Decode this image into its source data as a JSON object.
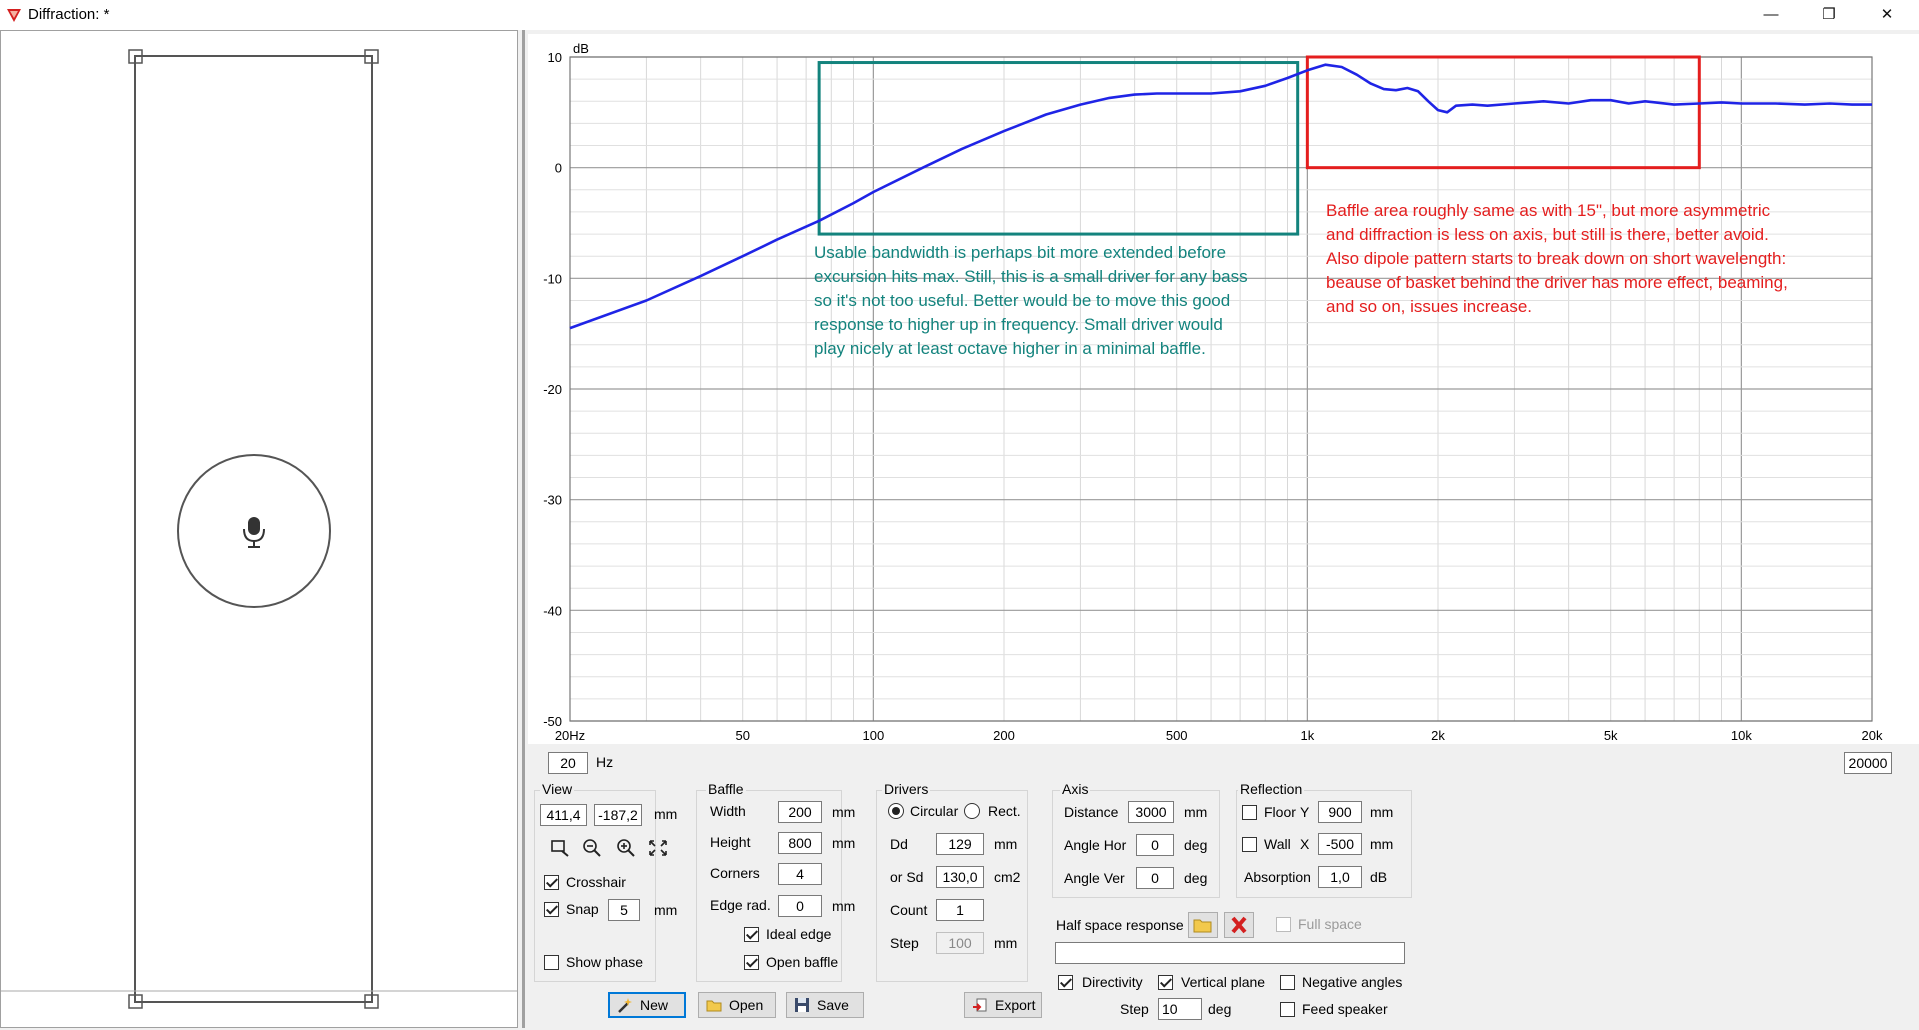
{
  "window": {
    "title": "Diffraction: *",
    "minimize": "—",
    "maximize": "❐",
    "close": "✕"
  },
  "colors": {
    "curve": "#1f24e6",
    "teal": "#13837d",
    "red": "#e41e1e",
    "grid": "#c8c8c8"
  },
  "chart": {
    "y_unit": "dB",
    "y_ticks": [
      "10",
      "0",
      "-10",
      "-20",
      "-30",
      "-40",
      "-50"
    ],
    "x_ticks": [
      "20Hz",
      "50",
      "100",
      "200",
      "500",
      "1k",
      "2k",
      "5k",
      "10k",
      "20k"
    ],
    "annotation_teal": "Usable bandwidth is perhaps bit more extended before\nexcursion hits max. Still, this is a small driver for any bass\nso it's not too useful. Better would be to move this good\nresponse to higher up in frequency. Small driver would\nplay nicely at least octave higher in a minimal baffle.",
    "annotation_red": "Baffle area roughly same as with 15\", but more asymmetric\nand diffraction is less on axis, but still is there, better avoid.\nAlso dipole pattern starts to break down on short wavelength:\nbeause of basket behind the driver has more effect, beaming,\nand so on, issues increase."
  },
  "chart_data": {
    "type": "line",
    "x_scale": "log",
    "xlim": [
      20,
      20000
    ],
    "ylim": [
      -50,
      10
    ],
    "ylabel": "dB",
    "x_tick_values": [
      20,
      50,
      100,
      200,
      500,
      1000,
      2000,
      5000,
      10000,
      20000
    ],
    "y_tick_values": [
      10,
      0,
      -10,
      -20,
      -30,
      -40,
      -50
    ],
    "series": [
      {
        "x": [
          20,
          30,
          40,
          50,
          60,
          75,
          90,
          100,
          130,
          160,
          200,
          250,
          300,
          350,
          400,
          450,
          500,
          600,
          700,
          800,
          900,
          1000,
          1100,
          1200,
          1300,
          1400,
          1500,
          1600,
          1700,
          1800,
          1900,
          2000,
          2100,
          2200,
          2400,
          2600,
          3000,
          3500,
          4000,
          4500,
          5000,
          5500,
          6000,
          7000,
          8000,
          9000,
          10000,
          12000,
          14000,
          16000,
          18000,
          20000
        ],
        "values": [
          -14.5,
          -12.0,
          -9.8,
          -8.0,
          -6.5,
          -4.8,
          -3.2,
          -2.2,
          0.0,
          1.7,
          3.3,
          4.8,
          5.7,
          6.3,
          6.6,
          6.7,
          6.7,
          6.7,
          6.9,
          7.4,
          8.1,
          8.8,
          9.3,
          9.1,
          8.4,
          7.6,
          7.1,
          7.0,
          7.2,
          6.9,
          6.0,
          5.2,
          5.0,
          5.6,
          5.7,
          5.6,
          5.8,
          6.0,
          5.8,
          6.1,
          6.1,
          5.8,
          6.0,
          5.7,
          5.8,
          5.9,
          5.8,
          5.8,
          5.7,
          5.8,
          5.7,
          5.7
        ]
      }
    ],
    "annotations": [
      {
        "box_x": [
          75,
          950
        ],
        "box_y": [
          -6,
          9.5
        ],
        "color": "teal"
      },
      {
        "box_x": [
          1000,
          8000
        ],
        "box_y": [
          0,
          10
        ],
        "color": "red"
      }
    ]
  },
  "freq": {
    "min": "20",
    "max": "20000",
    "unit": "Hz"
  },
  "view": {
    "title": "View",
    "x": "411,4",
    "y": "-187,2",
    "unit": "mm",
    "crosshair": "Crosshair",
    "snap": "Snap",
    "snap_value": "5",
    "snap_unit": "mm",
    "show_phase": "Show phase",
    "icons": [
      "zoom-fit-icon",
      "zoom-out-icon",
      "zoom-in-icon",
      "fullscreen-icon"
    ]
  },
  "baffle": {
    "title": "Baffle",
    "width_label": "Width",
    "width": "200",
    "height_label": "Height",
    "height": "800",
    "corners_label": "Corners",
    "corners": "4",
    "edge_label": "Edge rad.",
    "edge": "0",
    "unit": "mm",
    "ideal_edge": "Ideal edge",
    "open_baffle": "Open baffle"
  },
  "drivers": {
    "title": "Drivers",
    "circular": "Circular",
    "rect": "Rect.",
    "dd_label": "Dd",
    "dd": "129",
    "dd_unit": "mm",
    "sd_label": "or Sd",
    "sd": "130,0",
    "sd_unit": "cm2",
    "count_label": "Count",
    "count": "1",
    "step_label": "Step",
    "step": "100",
    "step_unit": "mm"
  },
  "axis": {
    "title": "Axis",
    "distance_label": "Distance",
    "distance": "3000",
    "distance_unit": "mm",
    "hor_label": "Angle Hor",
    "hor": "0",
    "ver_label": "Angle Ver",
    "ver": "0",
    "deg": "deg"
  },
  "reflection": {
    "title": "Reflection",
    "floor_label": "Floor",
    "floor_axis": "Y",
    "floor": "900",
    "wall_label": "Wall",
    "wall_axis": "X",
    "wall": "-500",
    "unit": "mm",
    "absorption_label": "Absorption",
    "absorption": "1,0",
    "absorption_unit": "dB"
  },
  "half_space": {
    "label": "Half space response",
    "full_space": "Full space",
    "path": ""
  },
  "options": {
    "directivity": "Directivity",
    "vertical_plane": "Vertical plane",
    "negative_angles": "Negative angles",
    "feed_speaker": "Feed speaker",
    "step_label": "Step",
    "step": "10",
    "step_unit": "deg"
  },
  "buttons": {
    "new": "New",
    "open": "Open",
    "save": "Save",
    "export": "Export"
  }
}
